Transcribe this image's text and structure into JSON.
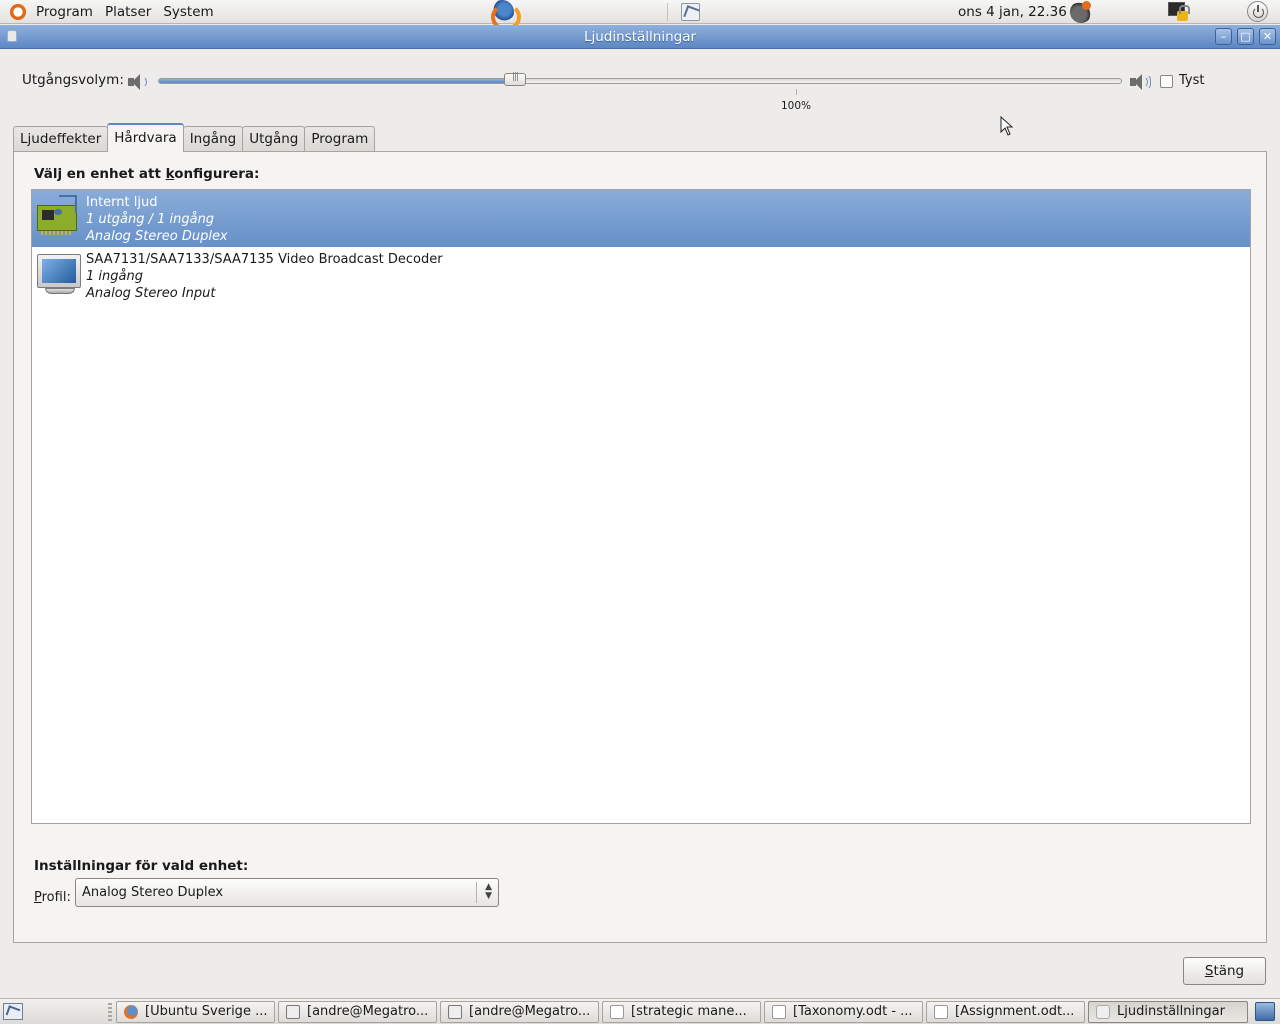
{
  "top_panel": {
    "menus": [
      "Program",
      "Platser",
      "System"
    ],
    "clock": "ons  4 jan, 22.36"
  },
  "window": {
    "title": "Ljudinställningar",
    "controls": {
      "minimize": "–",
      "maximize": "□",
      "close": "✕"
    }
  },
  "volume": {
    "label": "Utgångsvolym:",
    "level_percent": 37,
    "tick_label": "100%",
    "tick_position_percent": 66,
    "mute_label": "Tyst",
    "mute_checked": false
  },
  "tabs": [
    {
      "label": "Ljudeffekter",
      "active": false
    },
    {
      "label": "Hårdvara",
      "active": true
    },
    {
      "label": "Ingång",
      "active": false
    },
    {
      "label": "Utgång",
      "active": false
    },
    {
      "label": "Program",
      "active": false
    }
  ],
  "hardware": {
    "section_title_pre": "Välj en enhet att ",
    "section_title_access": "k",
    "section_title_post": "onfigurera:",
    "devices": [
      {
        "name": "Internt ljud",
        "io": "1 utgång / 1 ingång",
        "profile": "Analog Stereo Duplex",
        "icon": "soundcard-icon",
        "selected": true
      },
      {
        "name": "SAA7131/SAA7133/SAA7135 Video Broadcast Decoder",
        "io": "1 ingång",
        "profile": "Analog Stereo Input",
        "icon": "monitor-icon",
        "selected": false
      }
    ],
    "settings_title": "Inställningar för vald enhet:",
    "profile_label_access": "P",
    "profile_label_rest": "rofil:",
    "profile_value": "Analog Stereo Duplex"
  },
  "close_button": {
    "access": "S",
    "rest": "täng"
  },
  "taskbar": {
    "tasks": [
      {
        "label": "[Ubuntu Sverige ...",
        "icon": "firefox-icon"
      },
      {
        "label": "[andre@Megatro...",
        "icon": "terminal-icon"
      },
      {
        "label": "[andre@Megatro...",
        "icon": "terminal-icon"
      },
      {
        "label": "[strategic mane...",
        "icon": "spreadsheet-icon"
      },
      {
        "label": "[Taxonomy.odt - ...",
        "icon": "document-icon"
      },
      {
        "label": "[Assignment.odt...",
        "icon": "document-icon"
      },
      {
        "label": "Ljudinställningar",
        "icon": "sound-prefs-icon",
        "active": true
      }
    ]
  }
}
